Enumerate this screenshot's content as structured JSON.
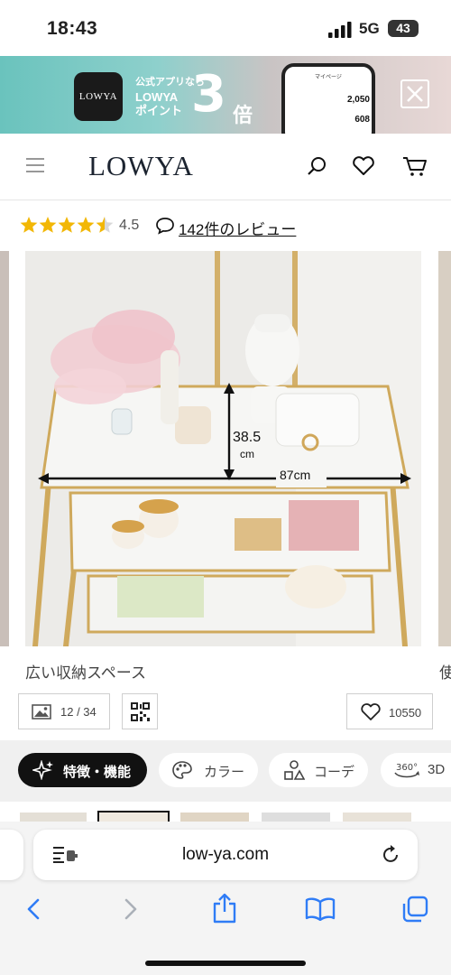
{
  "status_bar": {
    "time": "18:43",
    "network": "5G",
    "battery": "43"
  },
  "banner": {
    "app_icon_text": "LOWYA",
    "line1": "公式アプリなら",
    "line2": "LOWYA ポイント",
    "multiplier": "3",
    "suffix": "倍",
    "phone_title": "マイページ",
    "phone_row1_value": "2,050",
    "phone_row2_value": "608",
    "phone_unit": "pt",
    "close_icon": "close-icon"
  },
  "header": {
    "logo": "LOWYA",
    "icons": [
      "menu-icon",
      "search-icon",
      "heart-icon",
      "cart-icon"
    ]
  },
  "rating": {
    "stars": 4.5,
    "score": "4.5",
    "reviews": "142件のレビュー"
  },
  "gallery": {
    "height_label": "38.5",
    "height_unit": "cm",
    "width_label": "87cm",
    "caption": "広い収納スペース",
    "caption_next": "使",
    "counter": "12 / 34",
    "favorites": "10550"
  },
  "tabs": [
    {
      "label": "特徴・機能",
      "icon": "sparkle-icon",
      "active": true
    },
    {
      "label": "カラー",
      "icon": "palette-icon",
      "active": false
    },
    {
      "label": "コーデ",
      "icon": "shapes-icon",
      "active": false
    },
    {
      "label": "3D",
      "icon": "360-icon",
      "active": false
    }
  ],
  "browser": {
    "url": "low-ya.com",
    "icons": [
      "back-icon",
      "forward-icon",
      "share-icon",
      "bookmarks-icon",
      "tabs-icon"
    ]
  },
  "colors": {
    "accent": "#f2b705",
    "banner": "#6ac3bd",
    "ios_blue": "#2f7cf6",
    "logo": "#1c2430"
  }
}
